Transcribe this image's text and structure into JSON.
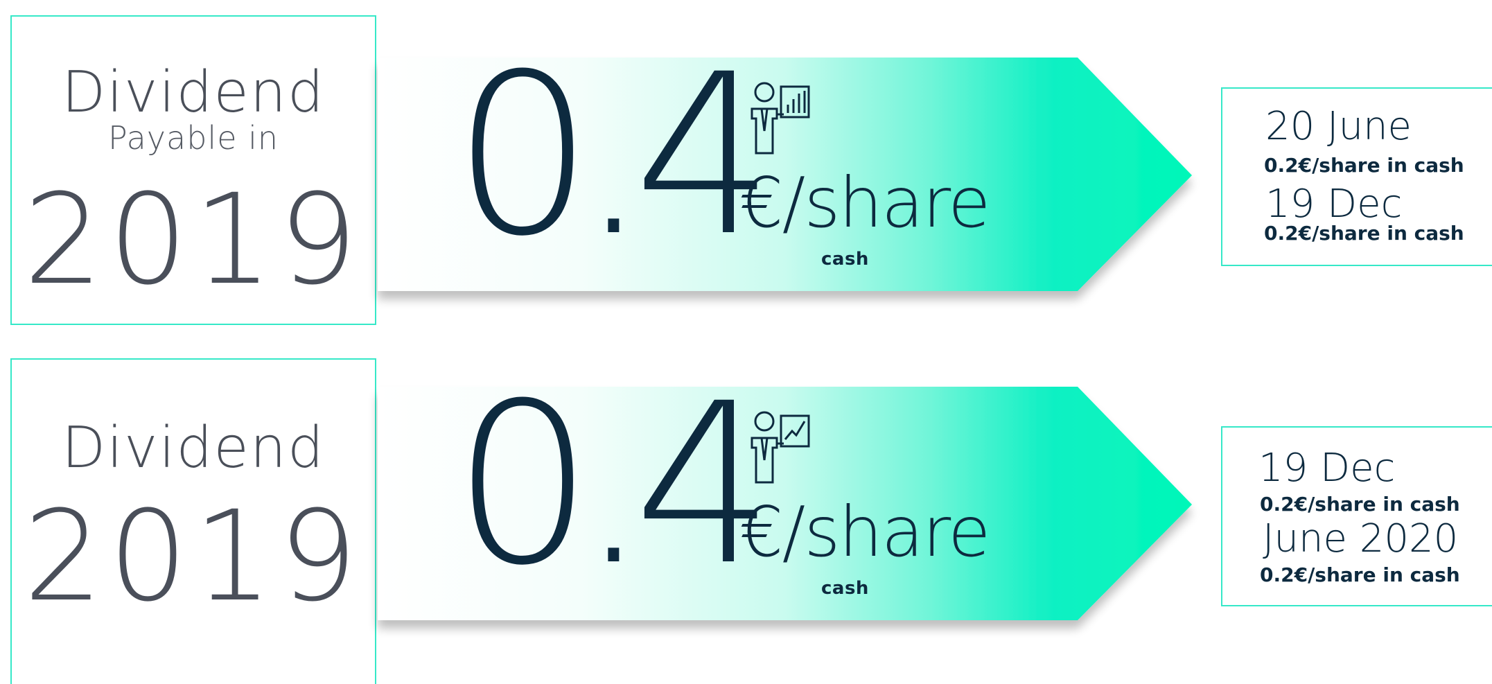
{
  "colors": {
    "accent": "#36e8c8",
    "navy": "#0d2a3f",
    "grey_text": "#4a4f59",
    "gradient_end": "#00f5c0"
  },
  "rows": [
    {
      "left": {
        "title": "Dividend",
        "subtitle": "Payable in",
        "year": "2019"
      },
      "arrow": {
        "amount": "0.4",
        "unit": "€/share",
        "note": "cash",
        "icon": "presenter-bar-chart-icon"
      },
      "payments": [
        {
          "date": "20 June",
          "detail": "0.2€/share in cash"
        },
        {
          "date": "19 Dec",
          "detail": "0.2€/share in cash"
        }
      ]
    },
    {
      "left": {
        "title": "Dividend",
        "year": "2019"
      },
      "arrow": {
        "amount": "0.4",
        "unit": "€/share",
        "note": "cash",
        "icon": "presenter-line-chart-icon"
      },
      "payments": [
        {
          "date": "19 Dec",
          "detail": "0.2€/share in cash"
        },
        {
          "date": "June 2020",
          "detail": "0.2€/share in cash"
        }
      ]
    }
  ]
}
